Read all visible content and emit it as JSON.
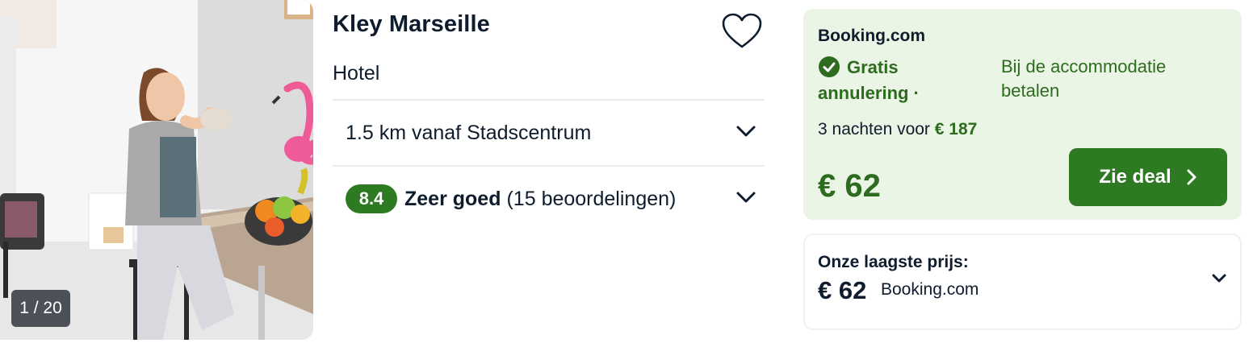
{
  "hotel": {
    "name": "Kley Marseille",
    "type": "Hotel",
    "distance": "1.5 km vanaf Stadscentrum",
    "rating_score": "8.4",
    "rating_label": "Zeer goed",
    "rating_count": "(15 beoordelingen)"
  },
  "photo": {
    "counter": "1 / 20"
  },
  "deal": {
    "provider": "Booking.com",
    "free_cancellation": "Gratis annulering ·",
    "payment": "Bij de accommodatie betalen",
    "nights_text": "3 nachten voor",
    "total_price": "€ 187",
    "nightly_price": "€ 62",
    "button_label": "Zie deal"
  },
  "lowest": {
    "label": "Onze laagste prijs:",
    "price": "€ 62",
    "provider": "Booking.com"
  },
  "colors": {
    "brand_green": "#2d7a22",
    "deal_background": "#ebf5e5",
    "text_dark": "#0e1c2e"
  },
  "icons": {
    "favorite": "heart-outline-icon",
    "expand": "chevron-down-icon",
    "free_cancel": "check-circle-icon",
    "deal": "chevron-right-icon"
  }
}
